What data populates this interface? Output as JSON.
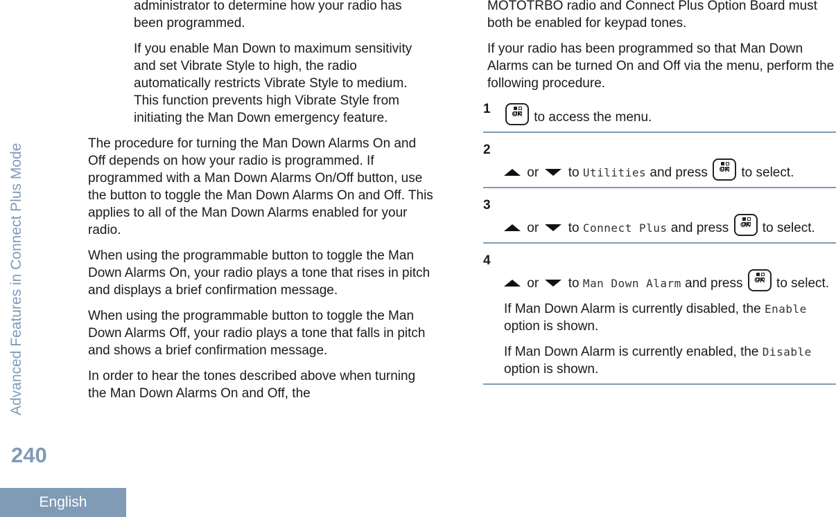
{
  "sidebar": {
    "section_title": "Advanced Features in Connect Plus Mode",
    "page_number": "240",
    "language_tab": "English"
  },
  "left_column": {
    "note_continued": "administrator to determine how your radio has been programmed.",
    "note_vibrate": "If you enable Man Down to maximum sensitivity and set Vibrate Style to high, the radio automatically restricts Vibrate Style to medium. This function prevents high Vibrate Style from initiating the Man Down emergency feature.",
    "para_procedure": "The procedure for turning the Man Down Alarms On and Off depends on how your radio is programmed. If programmed with a Man Down Alarms On/Off button, use the button to toggle the Man Down Alarms On and Off. This applies to all of the Man Down Alarms enabled for your radio.",
    "para_on": "When using the programmable button to toggle the Man Down Alarms On, your radio plays a tone that rises in pitch and displays a brief confirmation message.",
    "para_off": "When using the programmable button to toggle the Man Down Alarms Off, your radio plays a tone that falls in pitch and shows a brief confirmation message.",
    "para_tones": "In order to hear the tones described above when turning the Man Down Alarms On and Off, the"
  },
  "right_column": {
    "para_keypad": "MOTOTRBO radio and Connect Plus Option Board must both be enabled for keypad tones.",
    "para_menu": "If your radio has been programmed so that Man Down Alarms can be turned On and Off via the menu, perform the following procedure.",
    "icons": {
      "ok_key": "ok-menu-key-icon",
      "up": "up-arrow-icon",
      "down": "down-arrow-icon"
    },
    "ok_label": "OK",
    "steps": [
      {
        "number": "1",
        "text_after_key": "to access the menu."
      },
      {
        "number": "2",
        "or": "or",
        "to": "to",
        "menu_item": "Utilities",
        "and_press": "and press",
        "after": "to select."
      },
      {
        "number": "3",
        "or": "or",
        "to": "to",
        "menu_item": "Connect Plus",
        "and_press": "and press",
        "after": "to select."
      },
      {
        "number": "4",
        "or": "or",
        "to": "to",
        "menu_item": "Man Down Alarm",
        "and_press": "and press",
        "after": "to select.",
        "result_disabled_pre": "If Man Down Alarm is currently disabled, the",
        "option_enable": "Enable",
        "result_disabled_post": "option is shown.",
        "result_enabled_pre": "If Man Down Alarm is currently enabled, the",
        "option_disable": "Disable",
        "result_enabled_post": "option is shown."
      }
    ]
  },
  "colors": {
    "accent": "#7f9bb6",
    "text": "#1a1a1a"
  }
}
